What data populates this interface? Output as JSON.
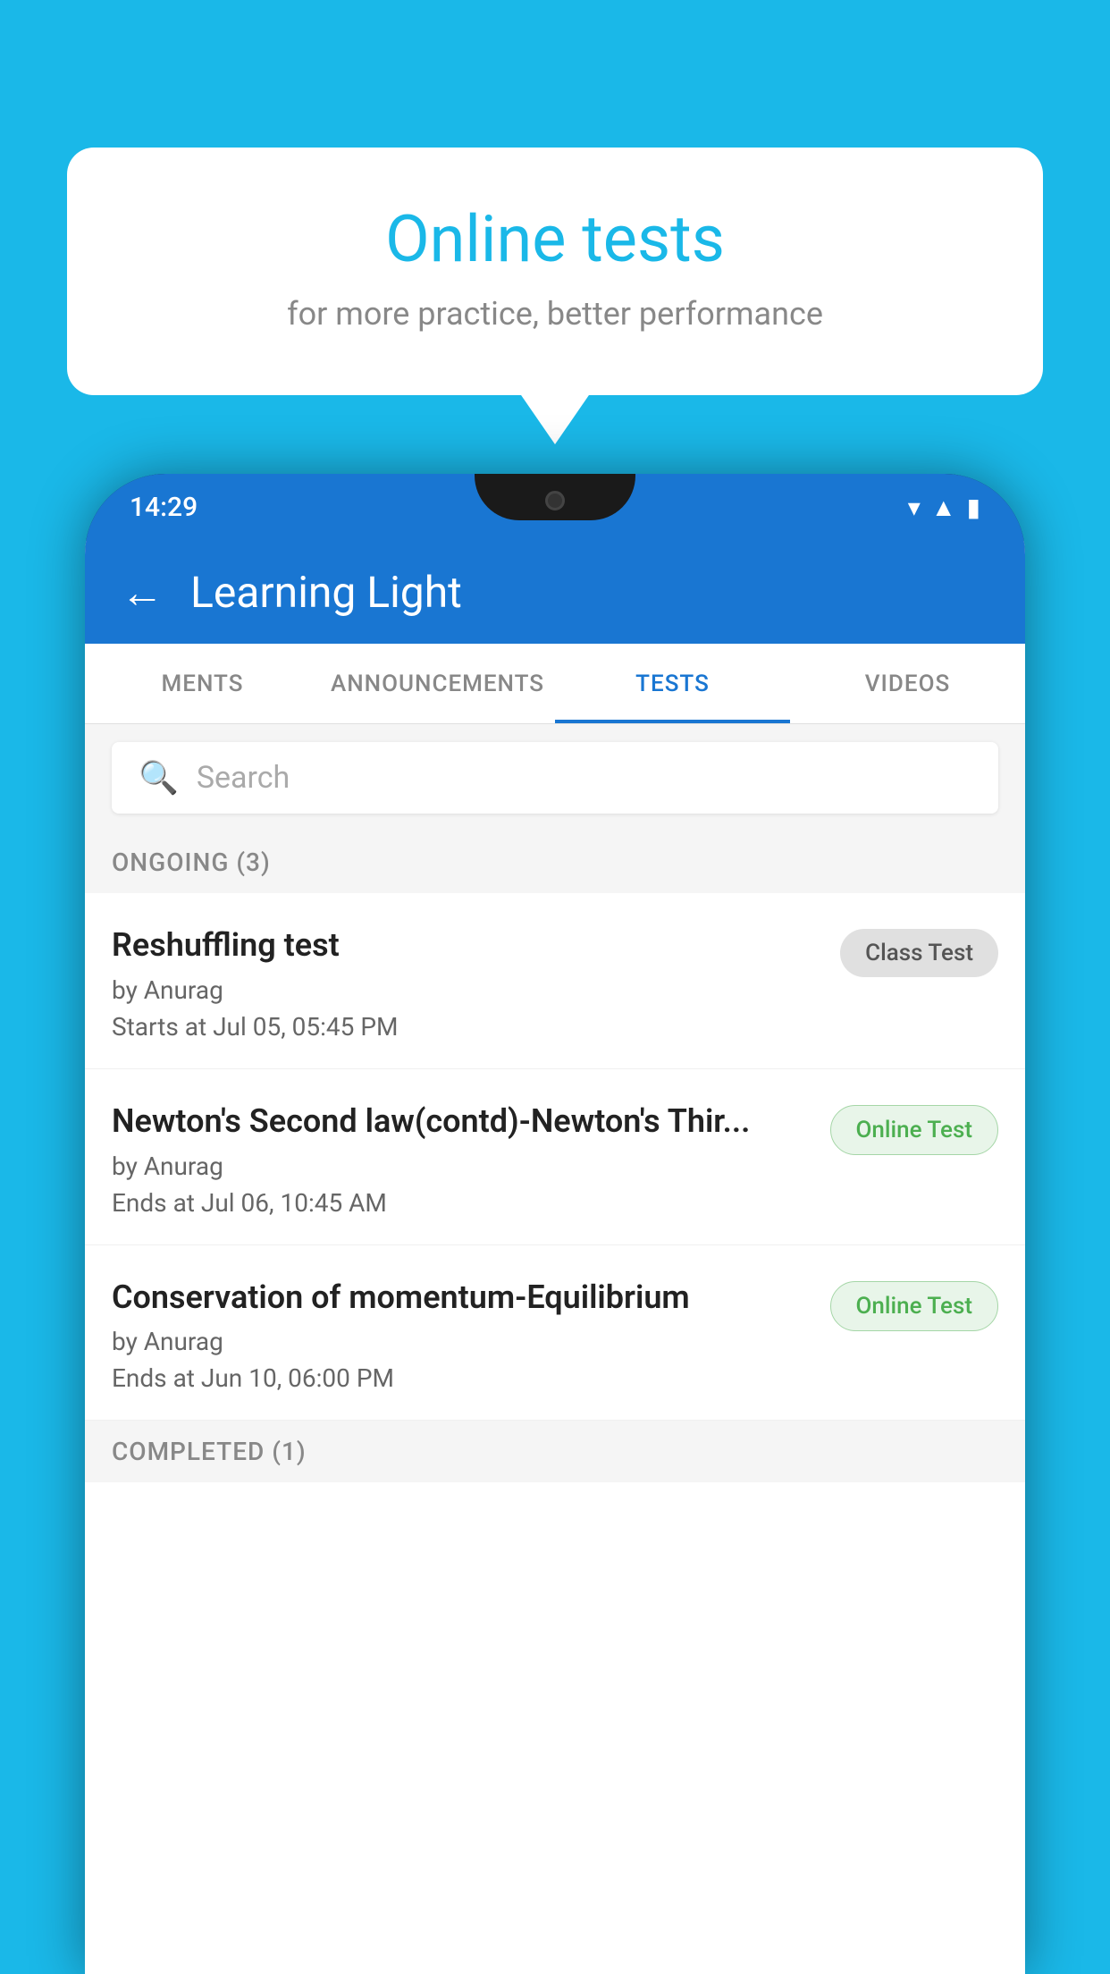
{
  "background": {
    "color": "#1ab8e8"
  },
  "speech_bubble": {
    "title": "Online tests",
    "subtitle": "for more practice, better performance"
  },
  "phone": {
    "status_bar": {
      "time": "14:29",
      "icons": [
        "wifi",
        "signal",
        "battery"
      ]
    },
    "app_bar": {
      "title": "Learning Light",
      "back_label": "←"
    },
    "tabs": [
      {
        "label": "MENTS",
        "active": false
      },
      {
        "label": "ANNOUNCEMENTS",
        "active": false
      },
      {
        "label": "TESTS",
        "active": true
      },
      {
        "label": "VIDEOS",
        "active": false
      }
    ],
    "search": {
      "placeholder": "Search"
    },
    "sections": [
      {
        "header": "ONGOING (3)",
        "items": [
          {
            "title": "Reshuffling test",
            "by": "by Anurag",
            "time_label": "Starts at",
            "time": "Jul 05, 05:45 PM",
            "badge": "Class Test",
            "badge_type": "class"
          },
          {
            "title": "Newton's Second law(contd)-Newton's Thir...",
            "by": "by Anurag",
            "time_label": "Ends at",
            "time": "Jul 06, 10:45 AM",
            "badge": "Online Test",
            "badge_type": "online"
          },
          {
            "title": "Conservation of momentum-Equilibrium",
            "by": "by Anurag",
            "time_label": "Ends at",
            "time": "Jun 10, 06:00 PM",
            "badge": "Online Test",
            "badge_type": "online"
          }
        ]
      },
      {
        "header": "COMPLETED (1)",
        "items": []
      }
    ]
  }
}
